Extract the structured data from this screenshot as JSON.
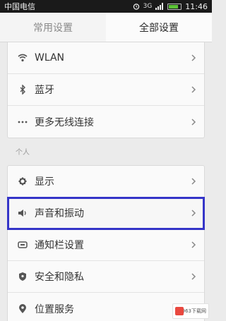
{
  "status_bar": {
    "carrier": "中国电信",
    "signal_text": "3G",
    "time": "11:46"
  },
  "tabs": [
    {
      "label": "常用设置"
    },
    {
      "label": "全部设置"
    }
  ],
  "wireless": {
    "items": [
      {
        "label": "WLAN",
        "icon": "wifi-icon"
      },
      {
        "label": "蓝牙",
        "icon": "bluetooth-icon"
      },
      {
        "label": "更多无线连接",
        "icon": "more-icon"
      }
    ]
  },
  "personal": {
    "title": "个人",
    "items": [
      {
        "label": "显示",
        "icon": "display-icon"
      },
      {
        "label": "声音和振动",
        "icon": "sound-icon"
      },
      {
        "label": "通知栏设置",
        "icon": "notification-icon"
      },
      {
        "label": "安全和隐私",
        "icon": "shield-icon"
      },
      {
        "label": "位置服务",
        "icon": "location-icon"
      }
    ]
  },
  "colors": {
    "highlight": "#3434c8",
    "statusbar_bg": "#1a1a1a",
    "battery": "#5bc236"
  },
  "watermark": {
    "text": "963下载网"
  }
}
